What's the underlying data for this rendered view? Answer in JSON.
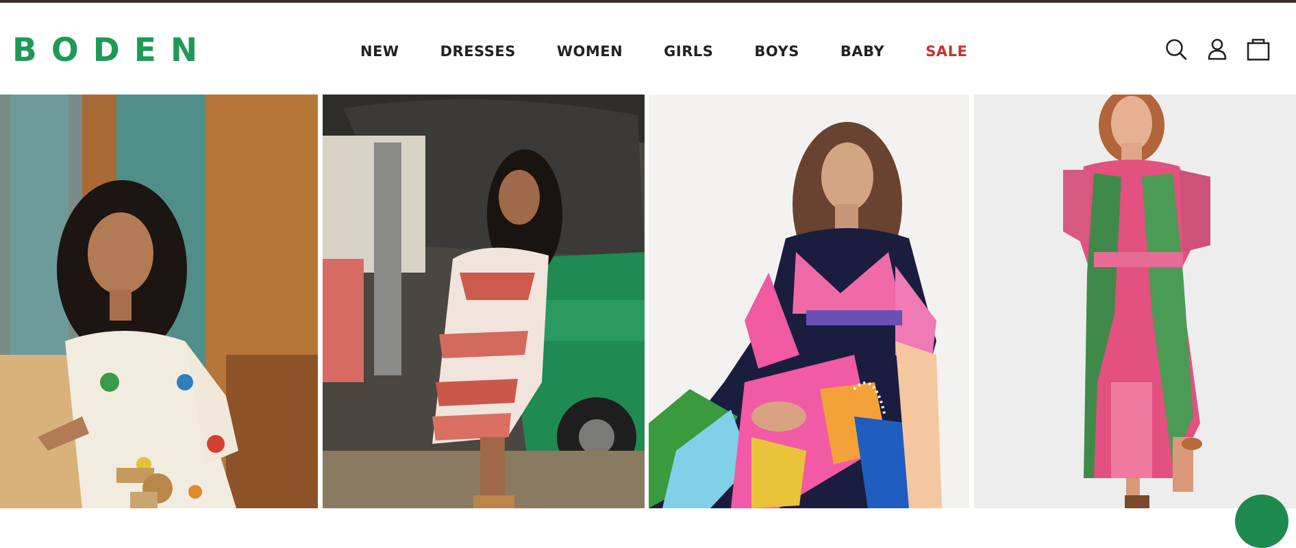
{
  "header": {
    "logo_text": "BODEN",
    "nav": [
      {
        "label": "NEW"
      },
      {
        "label": "DRESSES"
      },
      {
        "label": "WOMEN"
      },
      {
        "label": "GIRLS"
      },
      {
        "label": "BOYS"
      },
      {
        "label": "BABY"
      },
      {
        "label": "SALE",
        "color": "#c8312c"
      }
    ],
    "icons": [
      "search-icon",
      "account-icon",
      "bag-icon"
    ]
  },
  "gallery": {
    "items": [
      {
        "alt": "Model smiling in white bird print shirt dress with woven belt by blue shutters"
      },
      {
        "alt": "Model in red and white embroidered dress stepping out of green tuk-tuk"
      },
      {
        "alt": "Model in pink and navy parrot print kaftan dress on white background"
      },
      {
        "alt": "Model in pink and green floral print shirt dress on white background"
      }
    ]
  },
  "colors": {
    "brand_green": "#1e9a56",
    "sale_red": "#c8312c",
    "nav_text": "#222222",
    "top_bar": "#3a2d29"
  }
}
